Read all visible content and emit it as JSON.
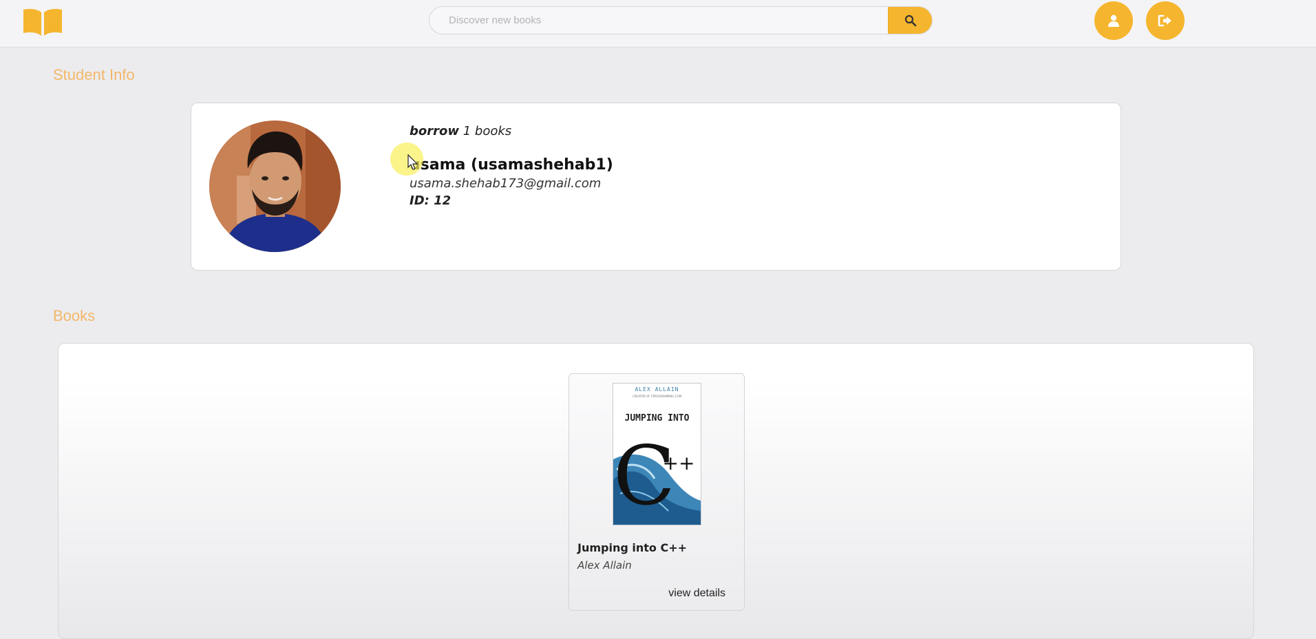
{
  "header": {
    "search_placeholder": "Discover new books"
  },
  "icons": {
    "logo": "open-book-icon",
    "search": "search-icon",
    "profile": "user-icon",
    "logout": "sign-out-icon"
  },
  "colors": {
    "accent": "#f5b52e",
    "section_title": "#f3b768",
    "background": "#ececef"
  },
  "student_section": {
    "title": "Student Info",
    "borrow_label": "borrow",
    "borrow_count": "1 books",
    "name": "usama (usamashehab1)",
    "email": "usama.shehab173@gmail.com",
    "id": "ID: 12"
  },
  "books_section": {
    "title": "Books",
    "books": [
      {
        "title": "Jumping into C++",
        "author": "Alex Allain",
        "cover_author": "ALEX ALLAIN",
        "cover_subtitle": "CREATOR OF CPROGRAMMING.COM",
        "cover_title": "JUMPING INTO",
        "cover_big_c": "C",
        "cover_plus": "++",
        "action_label": "view details"
      }
    ]
  }
}
